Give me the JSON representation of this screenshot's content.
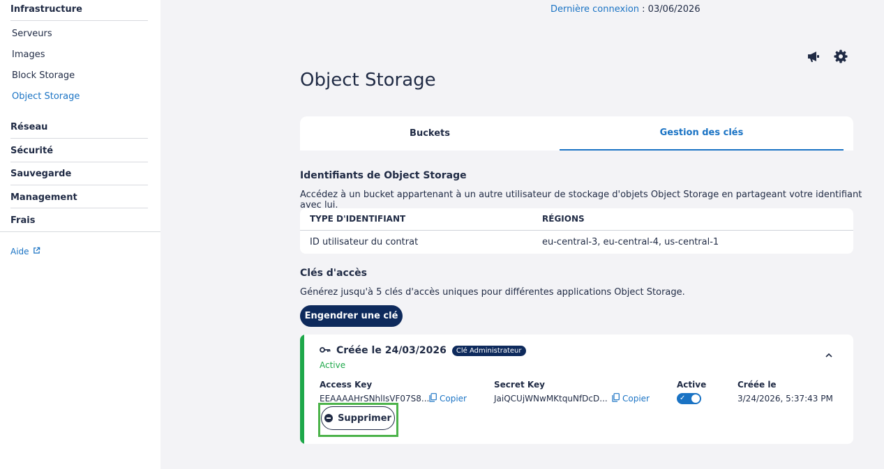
{
  "sidebar": {
    "infrastructure": "Infrastructure",
    "items": [
      "Serveurs",
      "Images",
      "Block Storage",
      "Object Storage"
    ],
    "sections": [
      "Réseau",
      "Sécurité",
      "Sauvegarde",
      "Management",
      "Frais"
    ],
    "help": "Aide"
  },
  "header": {
    "last_login_label": "Dernière connexion",
    "last_login_sep": " : ",
    "last_login_value": "03/06/2026",
    "icons": [
      "megaphone-icon",
      "gear-icon"
    ]
  },
  "page": {
    "title": "Object Storage",
    "tabs": [
      "Buckets",
      "Gestion des clés"
    ]
  },
  "identifiers": {
    "title": "Identifiants de Object Storage",
    "description": "Accédez à un bucket appartenant à un autre utilisateur de stockage d'objets Object Storage en partageant votre identifiant avec lui.",
    "columns": [
      "TYPE D'IDENTIFIANT",
      "RÉGIONS"
    ],
    "row": [
      "ID utilisateur du contrat",
      "eu-central-3, eu-central-4, us-central-1"
    ]
  },
  "access_keys": {
    "title": "Clés d'accès",
    "description": "Générez jusqu'à 5 clés d'accès uniques pour différentes applications Object Storage.",
    "generate_button": "Engendrer une clé",
    "key": {
      "title": "Créée le 24/03/2026",
      "badge": "Clé Administrateur",
      "status": "Active",
      "access_key_label": "Access Key",
      "access_key_value": "EEAAAAHrSNhlIsVF07S8...",
      "secret_key_label": "Secret Key",
      "secret_key_value": "JaiQCUjWNwMKtquNfDcD...",
      "copy_label": "Copier",
      "active_label": "Active",
      "active": true,
      "created_label": "Créée le",
      "created_value": "3/24/2026, 5:37:43 PM",
      "delete_button": "Supprimer"
    }
  },
  "colors": {
    "accent": "#1a73c4",
    "navy": "#0e2a5c",
    "success": "#1ea84a",
    "highlight": "#4cb34a"
  }
}
